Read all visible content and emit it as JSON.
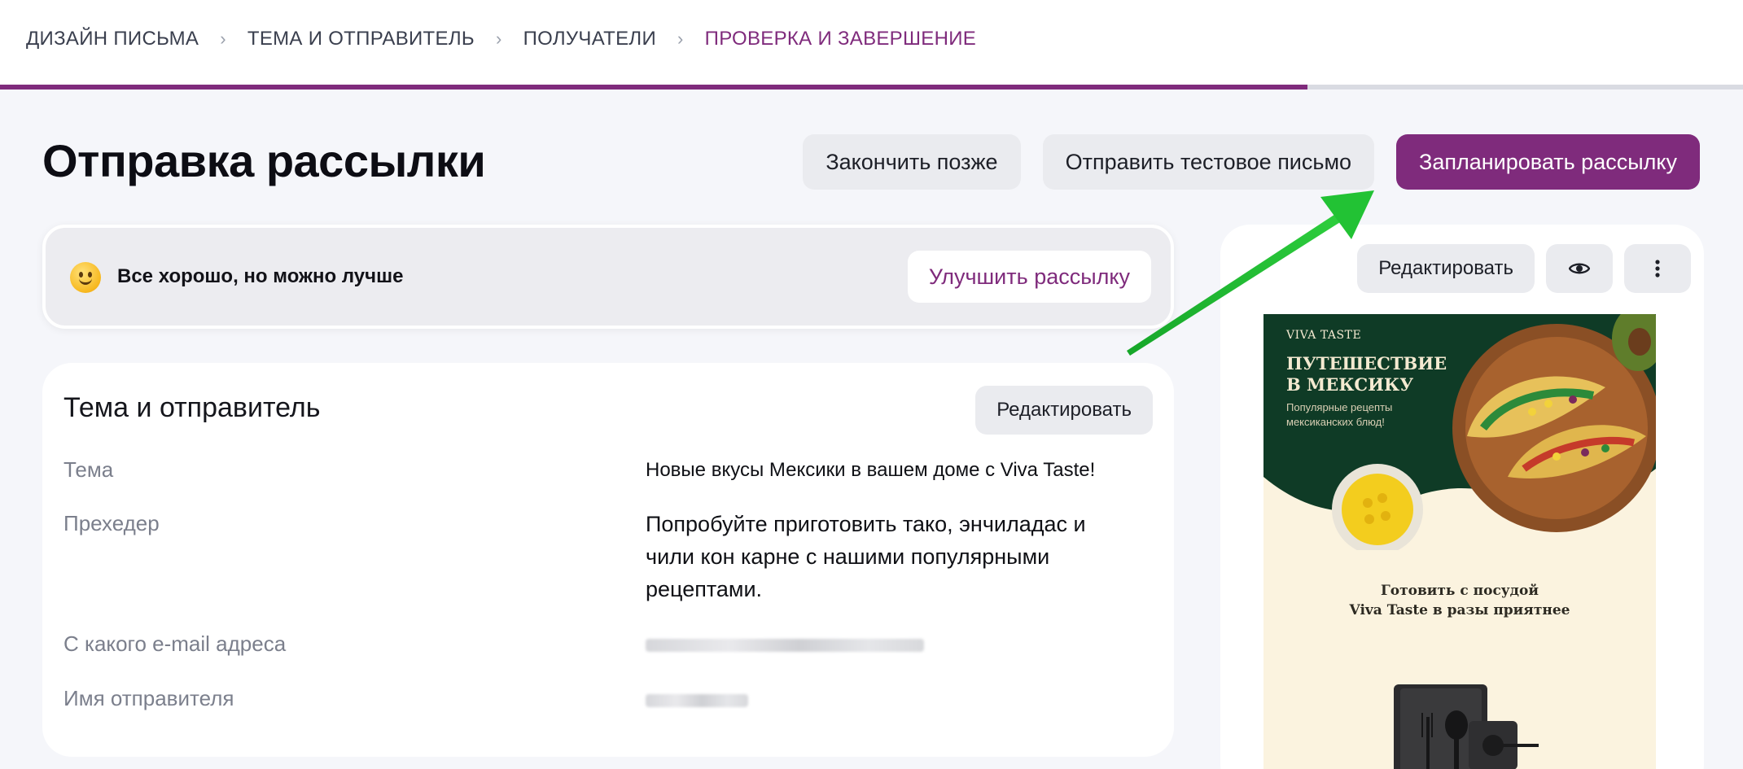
{
  "steps": {
    "items": [
      {
        "label": "ДИЗАЙН ПИСЬМА",
        "active": false
      },
      {
        "label": "ТЕМА И ОТПРАВИТЕЛЬ",
        "active": false
      },
      {
        "label": "ПОЛУЧАТЕЛИ",
        "active": false
      },
      {
        "label": "ПРОВЕРКА И ЗАВЕРШЕНИЕ",
        "active": true
      }
    ],
    "separator": "›",
    "progress": 0.75
  },
  "header": {
    "title": "Отправка рассылки",
    "finish_later_label": "Закончить позже",
    "send_test_label": "Отправить тестовое письмо",
    "schedule_label": "Запланировать рассылку"
  },
  "score": {
    "text": "Все хорошо, но можно лучше",
    "improve_label": "Улучшить рассылку"
  },
  "details": {
    "title": "Тема и отправитель",
    "edit_label": "Редактировать",
    "subject_label": "Тема",
    "subject_value": "Новые вкусы Мексики в вашем доме с Viva Taste!",
    "preheader_label": "Прехедер",
    "preheader_value": "Попробуйте приготовить тако, энчиладас и чили кон карне с нашими популярными рецептами.",
    "email_label": "С какого e-mail адреса",
    "sender_label": "Имя отправителя"
  },
  "preview": {
    "edit_label": "Редактировать",
    "icons": [
      "eye-icon",
      "more-vertical-icon"
    ],
    "email": {
      "brand": "VIVA TASTE",
      "headline_line1": "ПУТЕШЕСТВИЕ",
      "headline_line2": "В МЕКСИКУ",
      "sub_line1": "Популярные рецепты",
      "sub_line2": "мексиканских блюд!",
      "tagline_line1": "Готовить с посудой",
      "tagline_line2": "Viva Taste в разы приятнее"
    }
  },
  "colors": {
    "accent": "#7f2b7c",
    "arrow": "#1db832",
    "hero_green": "#0f3b26"
  }
}
